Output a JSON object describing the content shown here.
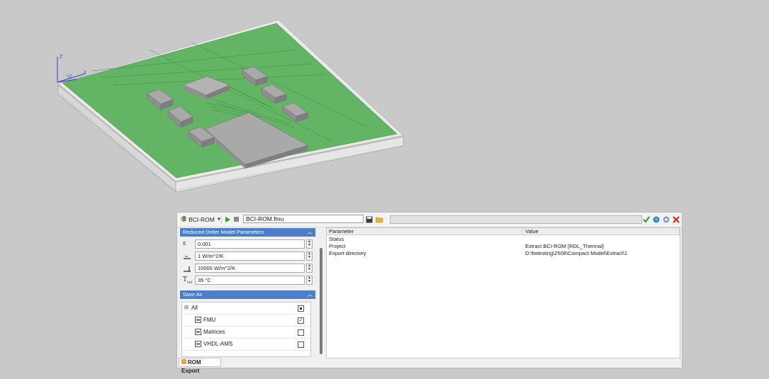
{
  "toolbar": {
    "template_name": "BCI-ROM",
    "file_name": "BCI-ROM.fmu",
    "icons": [
      "rom-icon",
      "dropdown-arrow-icon",
      "play-icon",
      "stop-icon",
      "save-icon",
      "folder-open-icon",
      "checkmark-icon",
      "help-icon",
      "settings-icon",
      "close-icon"
    ],
    "accent_colors": {
      "ok": "#1e9e1e",
      "close": "#d42020",
      "header": "#4a7ec9"
    }
  },
  "rom_parameters": {
    "header": "Reduced Order Model Parameters",
    "rows": [
      {
        "symbol": "ε",
        "icon": "epsilon-icon",
        "value": "0.001"
      },
      {
        "symbol": "",
        "icon": "heat-transfer-top-icon",
        "value": "1 W/m^2/K"
      },
      {
        "symbol": "",
        "icon": "heat-transfer-side-icon",
        "value": "10000 W/m^2/K"
      },
      {
        "symbol": "T",
        "sub": "ref",
        "icon": "reference-temperature-icon",
        "value": "35 °C"
      }
    ]
  },
  "save_as": {
    "header": "Save As",
    "items": [
      {
        "label": "All",
        "state": "partial"
      },
      {
        "label": "FMU",
        "state": "checked"
      },
      {
        "label": "Matrices",
        "state": "unchecked"
      },
      {
        "label": "VHDL-AMS",
        "state": "unchecked"
      }
    ]
  },
  "table": {
    "columns": [
      "Parameter",
      "Value"
    ],
    "rows": [
      [
        "Status",
        ""
      ],
      [
        "Project",
        "Extract BCI-ROM [RDL_Thermal]"
      ],
      [
        "Export directory",
        "D:\\fwtesting\\2508\\Compact Model\\Extract\\1"
      ]
    ]
  },
  "bottom_tab": {
    "label": "ROM Export"
  },
  "viewport": {
    "axis_labels": {
      "z": "Z",
      "x": "X",
      "y": "YZ"
    },
    "board_color": "#63b565",
    "component_color": "#a8a8a8"
  }
}
